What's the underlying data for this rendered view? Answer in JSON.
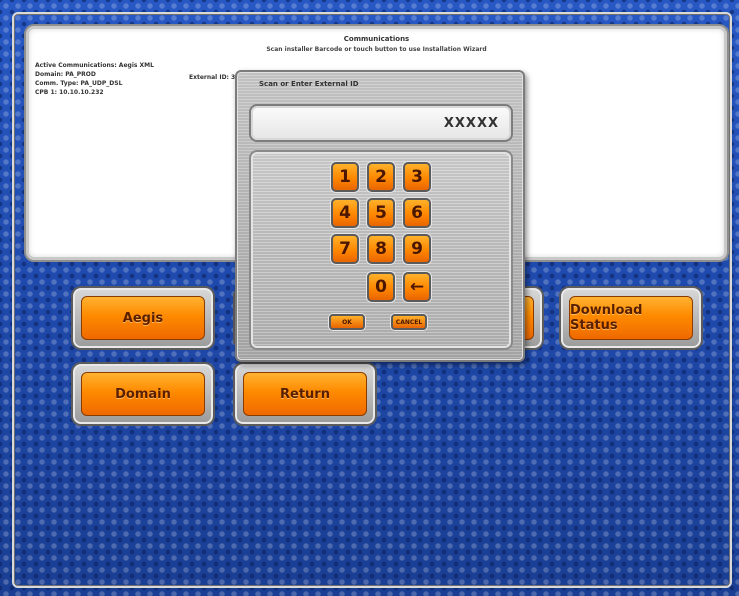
{
  "info": {
    "title": "Communications",
    "subtitle": "Scan installer Barcode or touch button to use Installation Wizard",
    "lines": [
      "Active Communications: Aegis XML",
      "Domain: PA_PROD",
      "Comm. Type: PA_UDP_DSL",
      "CPB 1: 10.10.10.232"
    ],
    "external_id_label": "External ID: 3"
  },
  "buttons": {
    "aegis": "Aegis",
    "download_status": "Download Status",
    "domain": "Domain",
    "return": "Return"
  },
  "dialog": {
    "title": "Scan or Enter External ID",
    "entry_value": "XXXXX",
    "keys": [
      "1",
      "2",
      "3",
      "4",
      "5",
      "6",
      "7",
      "8",
      "9",
      "0"
    ],
    "backspace": "←",
    "ok": "OK",
    "cancel": "CANCEL"
  },
  "colors": {
    "background_blue": "#1d47a6",
    "button_orange": "#ff8a00",
    "panel_white": "#ffffff",
    "dialog_gray": "#b9b9b9"
  }
}
